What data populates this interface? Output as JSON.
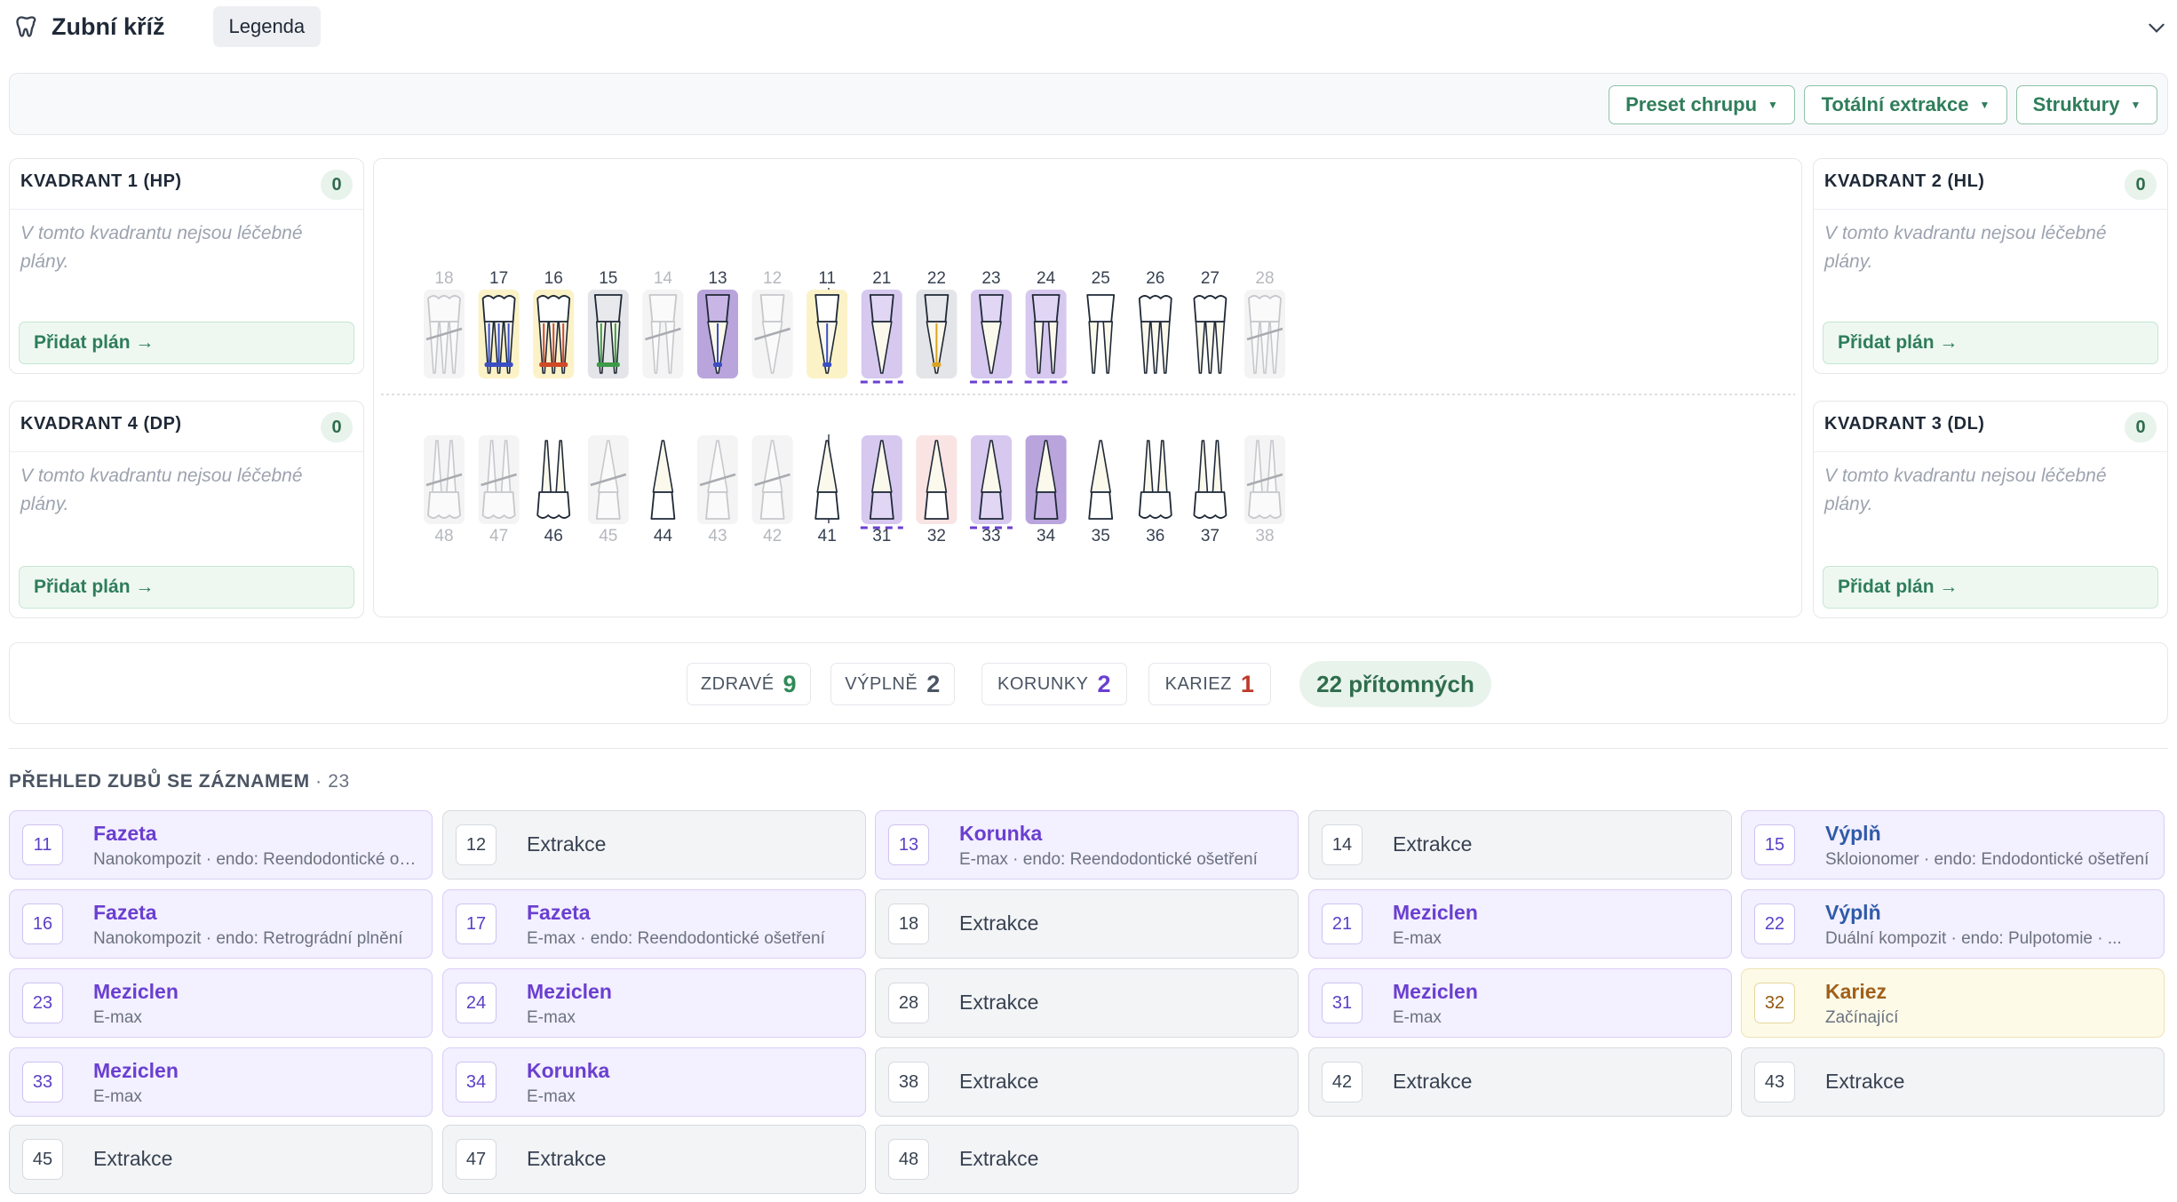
{
  "header": {
    "title": "Zubní kříž",
    "legend_label": "Legenda"
  },
  "toolbar": {
    "preset": "Preset chrupu",
    "extraction": "Totální extrakce",
    "structures": "Struktury"
  },
  "quadrants": {
    "q1": {
      "title": "KVADRANT 1 (HP)",
      "count": "0",
      "empty": "V tomto kvadrantu nejsou léčebné plány.",
      "add": "Přidat plán →"
    },
    "q2": {
      "title": "KVADRANT 2 (HL)",
      "count": "0",
      "empty": "V tomto kvadrantu nejsou léčebné plány.",
      "add": "Přidat plán →"
    },
    "q4": {
      "title": "KVADRANT 4 (DP)",
      "count": "0",
      "empty": "V tomto kvadrantu nejsou léčebné plány.",
      "add": "Přidat plán →"
    },
    "q3": {
      "title": "KVADRANT 3 (DL)",
      "count": "0",
      "empty": "V tomto kvadrantu nejsou léčebné plány.",
      "add": "Přidat plán →"
    }
  },
  "colors": {
    "filling": "#fbf2c7",
    "crown": "#d6c8ef",
    "crown_dark": "#b9a4dc",
    "caries": "#f9e3e3",
    "extracted": "#f4f4f5",
    "gray": "#e4e5e8",
    "accent": "#2f7d5a"
  },
  "chart_data": {
    "type": "table",
    "upper": [
      {
        "n": "18",
        "state": "extracted",
        "roots": 3
      },
      {
        "n": "17",
        "state": "filling",
        "roots": 3,
        "canal": "#3b4fc4"
      },
      {
        "n": "16",
        "state": "filling",
        "roots": 3,
        "canal": "#d04a25"
      },
      {
        "n": "15",
        "state": "gray",
        "roots": 2,
        "canal": "#3d9a47"
      },
      {
        "n": "14",
        "state": "extracted",
        "roots": 2
      },
      {
        "n": "13",
        "state": "crown_dark",
        "roots": 1,
        "canal": "#3b4fc4"
      },
      {
        "n": "12",
        "state": "extracted",
        "roots": 1
      },
      {
        "n": "11",
        "state": "filling",
        "roots": 1,
        "canal": "#3b4fc4"
      },
      {
        "n": "21",
        "state": "crown",
        "roots": 1,
        "dashed": true
      },
      {
        "n": "22",
        "state": "gray",
        "roots": 1,
        "canal": "#d9a320"
      },
      {
        "n": "23",
        "state": "crown",
        "roots": 1,
        "dashed": true
      },
      {
        "n": "24",
        "state": "crown",
        "roots": 2,
        "dashed": true
      },
      {
        "n": "25",
        "state": "healthy",
        "roots": 2
      },
      {
        "n": "26",
        "state": "healthy",
        "roots": 3
      },
      {
        "n": "27",
        "state": "healthy",
        "roots": 3
      },
      {
        "n": "28",
        "state": "extracted",
        "roots": 3
      }
    ],
    "lower": [
      {
        "n": "48",
        "state": "extracted",
        "roots": 2
      },
      {
        "n": "47",
        "state": "extracted",
        "roots": 2
      },
      {
        "n": "46",
        "state": "healthy",
        "roots": 2
      },
      {
        "n": "45",
        "state": "extracted",
        "roots": 1
      },
      {
        "n": "44",
        "state": "healthy",
        "roots": 1
      },
      {
        "n": "43",
        "state": "extracted",
        "roots": 1
      },
      {
        "n": "42",
        "state": "extracted",
        "roots": 1
      },
      {
        "n": "41",
        "state": "healthy",
        "roots": 1
      },
      {
        "n": "31",
        "state": "crown",
        "roots": 1,
        "dashed": true
      },
      {
        "n": "32",
        "state": "caries",
        "roots": 1
      },
      {
        "n": "33",
        "state": "crown",
        "roots": 1,
        "dashed": true
      },
      {
        "n": "34",
        "state": "crown_dark",
        "roots": 1
      },
      {
        "n": "35",
        "state": "healthy",
        "roots": 1
      },
      {
        "n": "36",
        "state": "healthy",
        "roots": 2
      },
      {
        "n": "37",
        "state": "healthy",
        "roots": 2
      },
      {
        "n": "38",
        "state": "extracted",
        "roots": 2
      }
    ]
  },
  "stats": {
    "healthy_label": "ZDRAVÉ",
    "healthy": "9",
    "fillings_label": "VÝPLNĚ",
    "fillings": "2",
    "crowns_label": "KORUNKY",
    "crowns": "2",
    "caries_label": "KARIEZ",
    "caries": "1",
    "present": "22 přítomných"
  },
  "overview": {
    "title": "PŘEHLED ZUBŮ SE ZÁZNAMEM",
    "count": "· 23",
    "cards": [
      {
        "n": "11",
        "type": "purple",
        "title": "Fazeta",
        "sub": "Nanokompozit · endo: Reendodontické ošetření"
      },
      {
        "n": "12",
        "type": "gray",
        "title": "Extrakce",
        "sub": ""
      },
      {
        "n": "13",
        "type": "purple",
        "title": "Korunka",
        "sub": "E-max · endo: Reendodontické ošetření"
      },
      {
        "n": "14",
        "type": "gray",
        "title": "Extrakce",
        "sub": ""
      },
      {
        "n": "15",
        "type": "purple teal",
        "title": "Výplň",
        "sub": "Skloionomer · endo: Endodontické ošetření"
      },
      {
        "n": "16",
        "type": "purple",
        "title": "Fazeta",
        "sub": "Nanokompozit · endo: Retrográdní plnění"
      },
      {
        "n": "17",
        "type": "purple",
        "title": "Fazeta",
        "sub": "E-max · endo: Reendodontické ošetření"
      },
      {
        "n": "18",
        "type": "gray",
        "title": "Extrakce",
        "sub": ""
      },
      {
        "n": "21",
        "type": "purple",
        "title": "Meziclen",
        "sub": "E-max"
      },
      {
        "n": "22",
        "type": "purple teal",
        "title": "Výplň",
        "sub": "Duální kompozit · endo: Pulpotomie · ..."
      },
      {
        "n": "23",
        "type": "purple",
        "title": "Meziclen",
        "sub": "E-max"
      },
      {
        "n": "24",
        "type": "purple",
        "title": "Meziclen",
        "sub": "E-max"
      },
      {
        "n": "28",
        "type": "gray",
        "title": "Extrakce",
        "sub": ""
      },
      {
        "n": "31",
        "type": "purple",
        "title": "Meziclen",
        "sub": "E-max"
      },
      {
        "n": "32",
        "type": "yellow",
        "title": "Kariez",
        "sub": "Začínající"
      },
      {
        "n": "33",
        "type": "purple",
        "title": "Meziclen",
        "sub": "E-max"
      },
      {
        "n": "34",
        "type": "purple",
        "title": "Korunka",
        "sub": "E-max"
      },
      {
        "n": "38",
        "type": "gray",
        "title": "Extrakce",
        "sub": ""
      },
      {
        "n": "42",
        "type": "gray",
        "title": "Extrakce",
        "sub": ""
      },
      {
        "n": "43",
        "type": "gray",
        "title": "Extrakce",
        "sub": ""
      },
      {
        "n": "45",
        "type": "gray",
        "title": "Extrakce",
        "sub": ""
      },
      {
        "n": "47",
        "type": "gray",
        "title": "Extrakce",
        "sub": ""
      },
      {
        "n": "48",
        "type": "gray",
        "title": "Extrakce",
        "sub": ""
      }
    ]
  }
}
